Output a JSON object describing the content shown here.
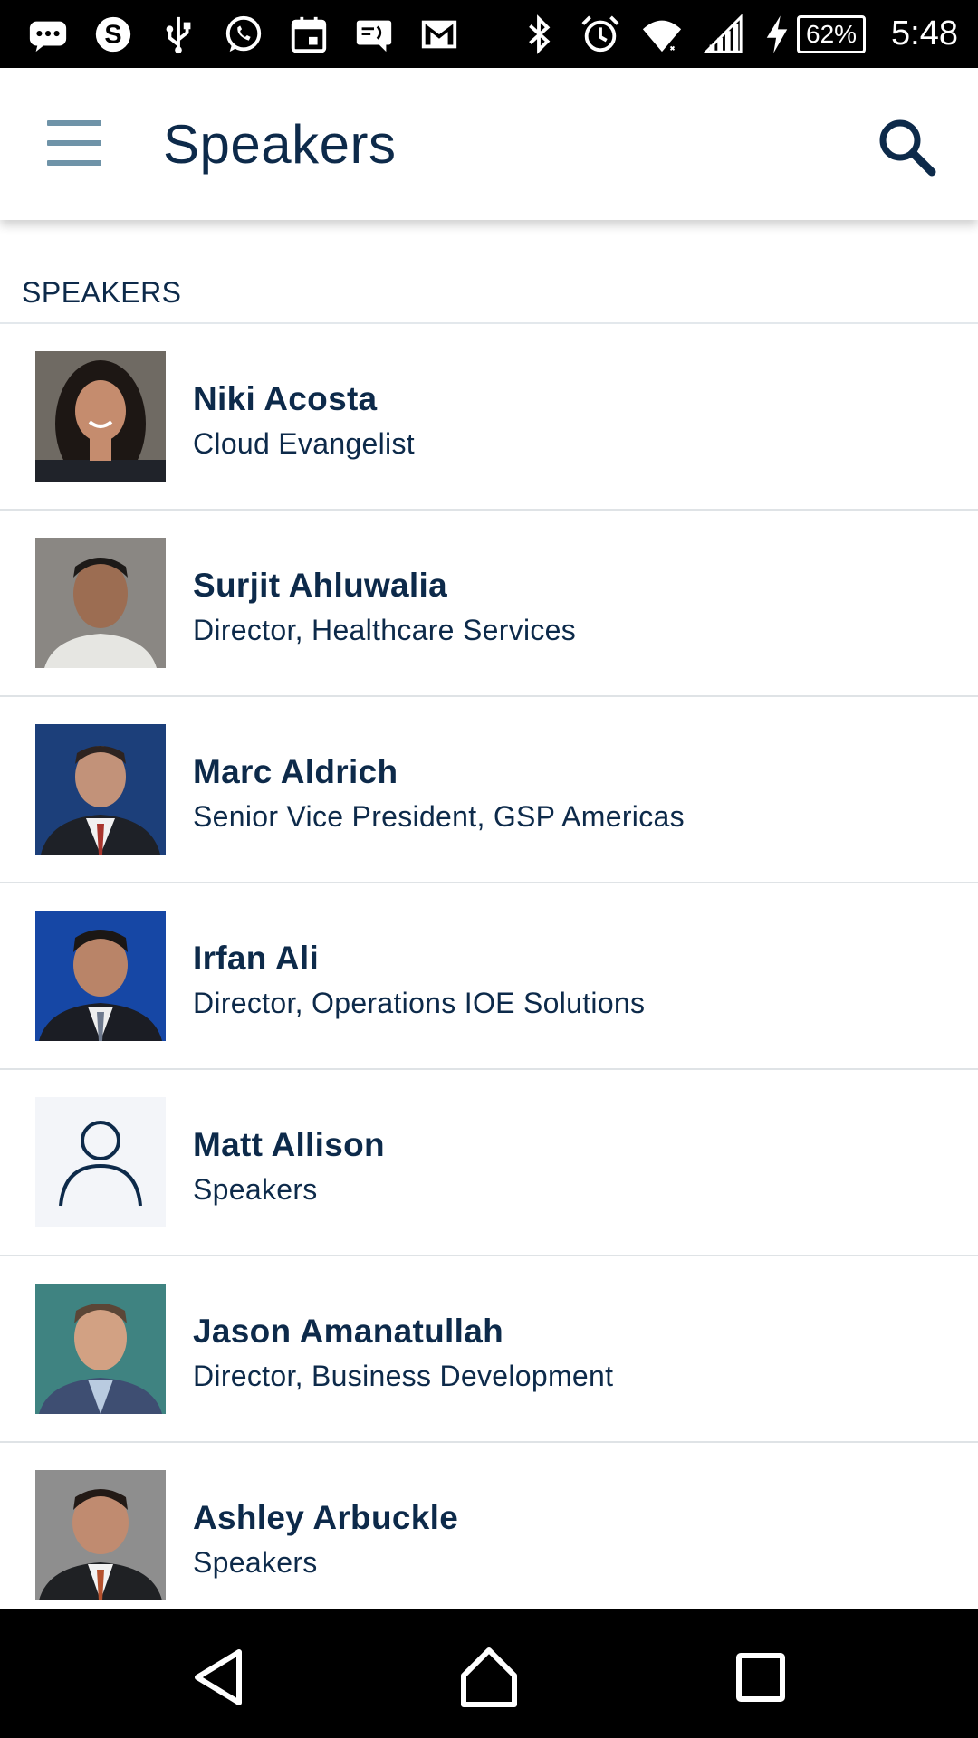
{
  "status_bar": {
    "left_icons": [
      "messages-icon",
      "skype-icon",
      "usb-icon",
      "whatsapp-icon",
      "calendar-icon",
      "sms-icon",
      "gmail-icon"
    ],
    "right_icons": [
      "bluetooth-icon",
      "alarm-icon",
      "wifi-icon",
      "signal-icon",
      "charging-icon"
    ],
    "battery": "62%",
    "time": "5:48"
  },
  "app_bar": {
    "title": "Speakers",
    "menu_icon": "hamburger-menu-icon",
    "search_icon": "search-icon"
  },
  "section": {
    "header": "SPEAKERS"
  },
  "speakers": [
    {
      "name": "Niki Acosta",
      "title": "Cloud Evangelist",
      "photo": "photo"
    },
    {
      "name": "Surjit Ahluwalia",
      "title": "Director, Healthcare Services",
      "photo": "photo"
    },
    {
      "name": "Marc Aldrich",
      "title": "Senior Vice President, GSP Americas",
      "photo": "photo"
    },
    {
      "name": "Irfan Ali",
      "title": "Director, Operations IOE Solutions",
      "photo": "photo"
    },
    {
      "name": "Matt Allison",
      "title": "Speakers",
      "photo": "placeholder"
    },
    {
      "name": "Jason Amanatullah",
      "title": "Director, Business Development",
      "photo": "photo"
    },
    {
      "name": "Ashley Arbuckle",
      "title": "Speakers",
      "photo": "photo"
    }
  ],
  "nav_bar": {
    "back_icon": "back-triangle-icon",
    "home_icon": "home-icon",
    "recents_icon": "recents-square-icon"
  },
  "colors": {
    "primary_text": "#0d2a4a",
    "menu_icon": "#6f93a8",
    "divider": "#dfe3e6",
    "placeholder_bg": "#f3f5f9"
  }
}
